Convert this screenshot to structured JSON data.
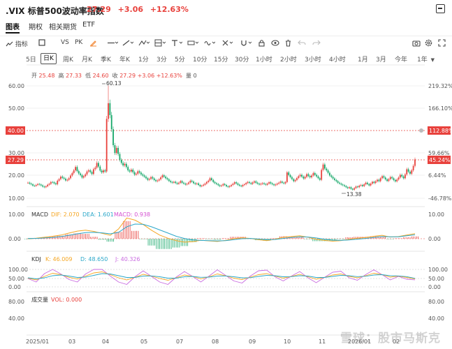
{
  "header": {
    "title": ".VIX 标普500波动率指数",
    "price": "27.29",
    "change": "+3.06",
    "change_pct": "+12.63%"
  },
  "tabs": [
    "图表",
    "期权",
    "相关期货",
    "ETF"
  ],
  "toolbar": {
    "indicator_label": "指标",
    "vs_label": "VS",
    "pk_label": "PK",
    "tools": [
      "draw-pen-icon",
      "line-icon",
      "trend-icon",
      "measure-icon",
      "grid-icon",
      "text-icon",
      "ruler-icon",
      "wave-icon",
      "cross-icon",
      "magnet-icon",
      "eye-icon",
      "trash-icon",
      "undo-icon",
      "redo-icon",
      "camera-icon",
      "settings-icon",
      "fullscreen-icon"
    ]
  },
  "periods": [
    "5日",
    "日K",
    "周K",
    "月K",
    "季K",
    "年K",
    "1分",
    "3分",
    "5分",
    "10分",
    "15分",
    "30分",
    "1小时",
    "2小时",
    "3小时",
    "4小时",
    "1月",
    "3月",
    "今年",
    "1年"
  ],
  "ohlc": {
    "open_label": "开",
    "open": "25.48",
    "high_label": "高",
    "high": "27.33",
    "low_label": "低",
    "low": "24.60",
    "close_label": "收",
    "close": "27.29",
    "change": "+3.06",
    "pct": "+12.63%",
    "volume_label": "量",
    "volume": "0"
  },
  "main_axis": {
    "left_ticks": [
      "60.00",
      "50.00",
      "40.00",
      "30.00",
      "20.00",
      "10.00"
    ],
    "right_ticks": [
      "219.32%",
      "166.10%",
      "112.88%",
      "59.66%",
      "6.44%",
      "-46.78%"
    ],
    "marker_left_1": "40.00",
    "marker_right_1": "112.88%",
    "marker_left_2": "27.29",
    "marker_right_2": "45.24%",
    "peak_label": "60.13",
    "trough_label": "13.38"
  },
  "macd": {
    "label": "MACD",
    "dif": "DIF: 2.070",
    "dea": "DEA: 1.601",
    "macd": "MACD: 0.938",
    "ticks": [
      "10.00",
      "0.00"
    ]
  },
  "kdj": {
    "label": "KDJ",
    "k": "K: 46.009",
    "d": "D: 48.650",
    "j": "J: 40.326",
    "ticks": [
      "100.00",
      "50.00",
      "0.00"
    ]
  },
  "volume": {
    "label": "成交量",
    "vol": "VOL: 0.000",
    "ticks": [
      "80.00",
      "40.00"
    ]
  },
  "x_axis": [
    "2025/01",
    "03",
    "04",
    "05",
    "07",
    "08",
    "09",
    "10",
    "11",
    "2026/01",
    "02"
  ],
  "watermark": "雪球：股市马斯克",
  "colors": {
    "up": "#e8413c",
    "down": "#17a86a",
    "dif": "#f5a623",
    "dea": "#2aa7c9",
    "macd": "#d44fd1",
    "k": "#f5a623",
    "d": "#2aa7c9",
    "j": "#c96be0"
  },
  "chart_data": [
    {
      "type": "candlestick",
      "title": ".VIX 标普500波动率指数",
      "x": [
        "2025/01",
        "03",
        "04",
        "05",
        "07",
        "08",
        "09",
        "10",
        "11",
        "2026/01",
        "02"
      ],
      "close": [
        16.9,
        16.5,
        16.2,
        15.6,
        15.5,
        15.9,
        16.3,
        16.1,
        15.7,
        15.2,
        14.9,
        15.3,
        16.0,
        16.4,
        17.2,
        17.1,
        16.6,
        16.2,
        17.8,
        18.5,
        19.6,
        19.1,
        18.7,
        17.9,
        18.2,
        18.9,
        20.1,
        21.2,
        22.4,
        23.9,
        22.1,
        21.0,
        20.3,
        19.2,
        19.8,
        20.6,
        21.9,
        22.4,
        21.7,
        20.8,
        22.9,
        23.6,
        25.7,
        24.1,
        22.3,
        21.5,
        22.4,
        21.9,
        45.3,
        52.3,
        47.0,
        40.7,
        33.6,
        30.1,
        32.4,
        29.7,
        27.1,
        25.7,
        24.6,
        25.3,
        23.9,
        22.4,
        21.9,
        22.7,
        21.6,
        20.5,
        20.9,
        22.0,
        21.4,
        20.6,
        20.1,
        19.6,
        18.9,
        18.2,
        18.6,
        19.4,
        18.8,
        18.1,
        17.6,
        17.9,
        18.4,
        19.3,
        20.2,
        19.6,
        18.9,
        18.4,
        17.7,
        17.2,
        16.9,
        17.3,
        16.8,
        16.4,
        16.9,
        17.6,
        16.9,
        16.5,
        16.1,
        16.4,
        17.0,
        17.8,
        17.4,
        16.7,
        16.3,
        16.6,
        15.9,
        15.3,
        15.6,
        16.0,
        16.5,
        17.2,
        17.8,
        18.9,
        18.1,
        17.2,
        16.7,
        16.3,
        15.8,
        15.4,
        15.7,
        16.3,
        15.9,
        15.3,
        15.0,
        15.4,
        15.9,
        16.4,
        17.1,
        16.6,
        16.0,
        15.6,
        15.3,
        15.9,
        16.2,
        16.8,
        17.2,
        16.8,
        16.4,
        17.0,
        17.5,
        16.9,
        16.5,
        16.1,
        16.4,
        16.7,
        16.3,
        16.0,
        16.5,
        17.1,
        16.6,
        16.2,
        15.8,
        16.1,
        16.5,
        16.9,
        17.4,
        16.9,
        16.6,
        17.2,
        21.5,
        20.3,
        19.4,
        18.5,
        17.6,
        18.1,
        19.0,
        19.8,
        20.4,
        19.6,
        18.8,
        19.5,
        20.7,
        19.9,
        19.3,
        20.1,
        21.2,
        20.4,
        19.7,
        18.9,
        18.2,
        22.6,
        25.0,
        23.2,
        22.4,
        21.3,
        20.1,
        19.5,
        18.8,
        18.1,
        17.6,
        16.9,
        16.5,
        16.1,
        15.8,
        15.4,
        14.9,
        14.5,
        14.9,
        14.2,
        13.8,
        14.5,
        15.2,
        14.9,
        15.6,
        15.9,
        15.4,
        16.2,
        16.9,
        16.3,
        15.7,
        16.5,
        17.3,
        16.8,
        17.5,
        18.2,
        17.6,
        18.9,
        19.8,
        19.2,
        18.4,
        17.7,
        18.5,
        19.4,
        18.9,
        18.1,
        17.5,
        18.3,
        19.2,
        20.4,
        19.7,
        18.9,
        20.6,
        22.9,
        21.8,
        20.9,
        22.4,
        24.4,
        27.29
      ],
      "ylim": [
        8.0,
        64.0
      ],
      "peak": 60.13,
      "trough": 13.38,
      "reference_lines": [
        40.0,
        27.29
      ]
    },
    {
      "type": "line",
      "title": "MACD",
      "series": [
        {
          "name": "DIF",
          "values": [
            0.0,
            0.2,
            0.6,
            1.0,
            1.5,
            2.3,
            3.1,
            3.5,
            3.0,
            2.2,
            1.4,
            4.0,
            8.5,
            7.6,
            5.8,
            3.5,
            1.5,
            0.2,
            -0.8,
            -1.4,
            -1.2,
            -0.6,
            -0.9,
            -1.1,
            -0.7,
            0.0,
            0.4,
            0.1,
            -0.4,
            -0.8,
            -0.2,
            0.6,
            0.9,
            1.2,
            0.6,
            -0.2,
            -0.7,
            -1.0,
            -0.8,
            -0.2,
            0.2,
            0.5,
            1.0,
            1.4,
            0.7,
            0.9,
            1.5,
            2.07
          ]
        },
        {
          "name": "DEA",
          "values": [
            0.1,
            0.1,
            0.3,
            0.5,
            0.9,
            1.4,
            2.0,
            2.5,
            2.6,
            2.4,
            2.0,
            2.6,
            4.9,
            6.0,
            5.9,
            4.9,
            3.6,
            2.3,
            1.0,
            0.1,
            -0.5,
            -0.7,
            -0.8,
            -0.9,
            -0.8,
            -0.4,
            0.0,
            0.1,
            -0.1,
            -0.4,
            -0.3,
            0.1,
            0.5,
            0.8,
            0.7,
            0.3,
            -0.2,
            -0.6,
            -0.7,
            -0.5,
            -0.2,
            0.1,
            0.5,
            0.9,
            0.8,
            0.8,
            1.2,
            1.601
          ]
        }
      ],
      "ticks": [
        10.0,
        0.0
      ]
    },
    {
      "type": "line",
      "title": "KDJ",
      "series": [
        {
          "name": "K",
          "values": [
            50,
            40,
            60,
            78,
            70,
            55,
            45,
            62,
            80,
            86,
            70,
            52,
            40,
            55,
            72,
            62,
            48,
            38,
            52,
            68,
            60,
            46,
            58,
            74,
            64,
            50,
            42,
            56,
            70,
            76,
            62,
            50,
            60,
            72,
            58,
            44,
            54,
            68,
            74,
            60,
            52,
            64,
            78,
            70,
            56,
            62,
            54,
            46.009
          ]
        },
        {
          "name": "D",
          "values": [
            52,
            46,
            52,
            64,
            68,
            62,
            54,
            56,
            66,
            76,
            74,
            64,
            54,
            54,
            62,
            63,
            58,
            50,
            50,
            58,
            60,
            55,
            56,
            62,
            63,
            58,
            52,
            53,
            60,
            66,
            64,
            58,
            59,
            64,
            62,
            54,
            54,
            60,
            66,
            64,
            59,
            61,
            68,
            70,
            64,
            63,
            59,
            48.65
          ]
        },
        {
          "name": "J",
          "values": [
            48,
            28,
            76,
            100,
            74,
            42,
            28,
            74,
            100,
            100,
            62,
            28,
            14,
            58,
            92,
            60,
            28,
            14,
            56,
            88,
            60,
            28,
            62,
            98,
            66,
            34,
            22,
            62,
            92,
            96,
            58,
            34,
            62,
            88,
            52,
            24,
            54,
            84,
            90,
            52,
            38,
            70,
            98,
            70,
            40,
            60,
            44,
            40.326
          ]
        }
      ],
      "ticks": [
        100.0,
        50.0,
        0.0
      ]
    }
  ]
}
